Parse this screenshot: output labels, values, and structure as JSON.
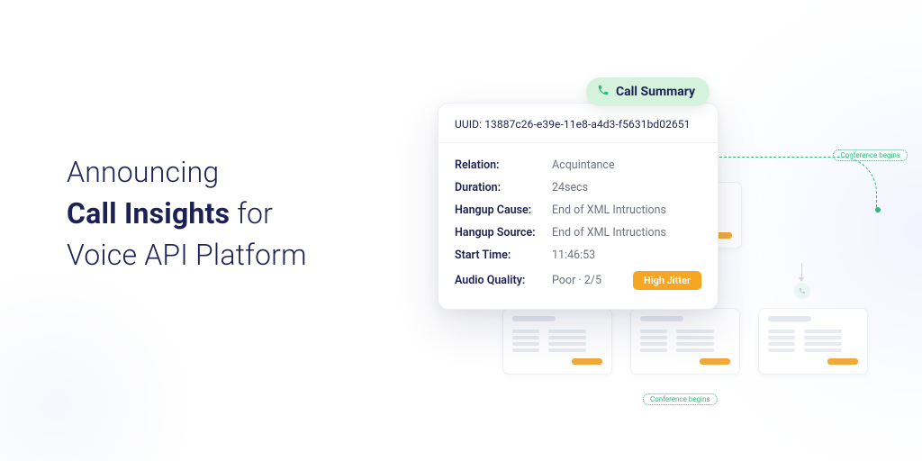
{
  "headline": {
    "line1": "Announcing",
    "line2_bold": "Call Insights",
    "line2_rest": " for",
    "line3": "Voice API Platform"
  },
  "pill": {
    "label": "Call Summary"
  },
  "summary": {
    "uuid_label": "UUID:",
    "uuid_value": "13887c26-e39e-11e8-a4d3-f5631bd02651",
    "rows": {
      "relation": {
        "k": "Relation:",
        "v": "Acquintance"
      },
      "duration": {
        "k": "Duration:",
        "v": "24secs"
      },
      "hangup_cause": {
        "k": "Hangup Cause:",
        "v": "End of XML Intructions"
      },
      "hangup_source": {
        "k": "Hangup Source:",
        "v": "End of XML Intructions"
      },
      "start_time": {
        "k": "Start Time:",
        "v": "11:46:53"
      },
      "audio_quality": {
        "k": "Audio Quality:",
        "v": "Poor · 2/5",
        "badge": "High Jitter"
      }
    }
  },
  "flow": {
    "label_top": "Conference begins",
    "label_bottom": "Conference begins"
  }
}
